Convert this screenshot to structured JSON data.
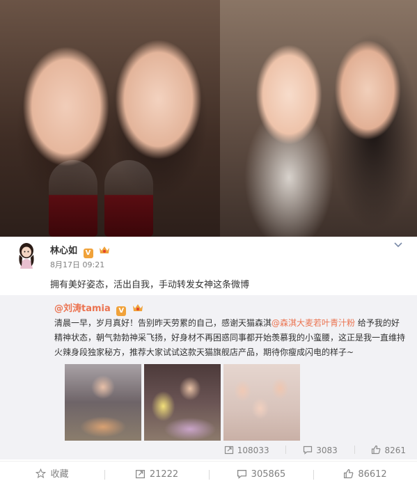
{
  "post": {
    "author": "林心如",
    "time": "8月17日 09:21",
    "text": "拥有美好姿态，活出自我，手动转发女神这条微博"
  },
  "repost": {
    "author": "@刘涛tamia",
    "text_part1": "清晨一早，岁月真好！告别昨天劳累的自己，感谢天猫森淇",
    "mention": "@森淇大麦若叶青汁粉",
    "text_part2": " 给予我的好精神状态，朝气勃勃神采飞扬，好身材不再困惑同事都开始羡慕我的小蛮腰，这正是我一直维持火辣身段独家秘方，推荐大家试试这款天猫旗舰店产品，期待你瘦成闪电的样子~",
    "reposts": "108033",
    "comments": "3083",
    "likes": "8261"
  },
  "actions": {
    "favorite": "收藏",
    "repost": "21222",
    "comment": "305865",
    "like": "86612"
  },
  "colors": {
    "accent": "#eb7350",
    "verified": "#f0a23a",
    "repost_bg": "#f2f2f5"
  }
}
